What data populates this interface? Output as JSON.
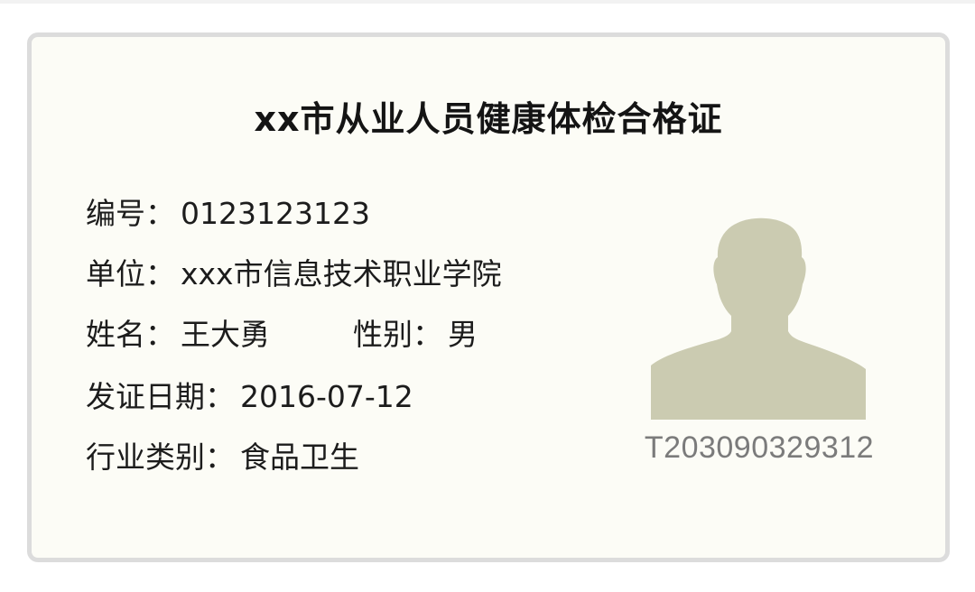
{
  "card": {
    "title": "xx市从业人员健康体检合格证",
    "colon": "：",
    "fields": {
      "number": {
        "label": "编号",
        "value": "0123123123"
      },
      "unit": {
        "label": "单位",
        "value": "xxx市信息技术职业学院"
      },
      "name": {
        "label": "姓名",
        "value": "王大勇"
      },
      "gender": {
        "label": "性别",
        "value": "男"
      },
      "issue_date": {
        "label": "发证日期",
        "value": "2016-07-12"
      },
      "category": {
        "label": "行业类别",
        "value": "食品卫生"
      }
    },
    "photo": {
      "icon": "person-silhouette-icon",
      "code": "T203090329312"
    }
  },
  "colors": {
    "card_background": "#fcfcf6",
    "card_border": "#dcdcdc",
    "silhouette": "#cbcbb1",
    "text": "#1c1c1c",
    "code_text": "#7b7b7b"
  }
}
